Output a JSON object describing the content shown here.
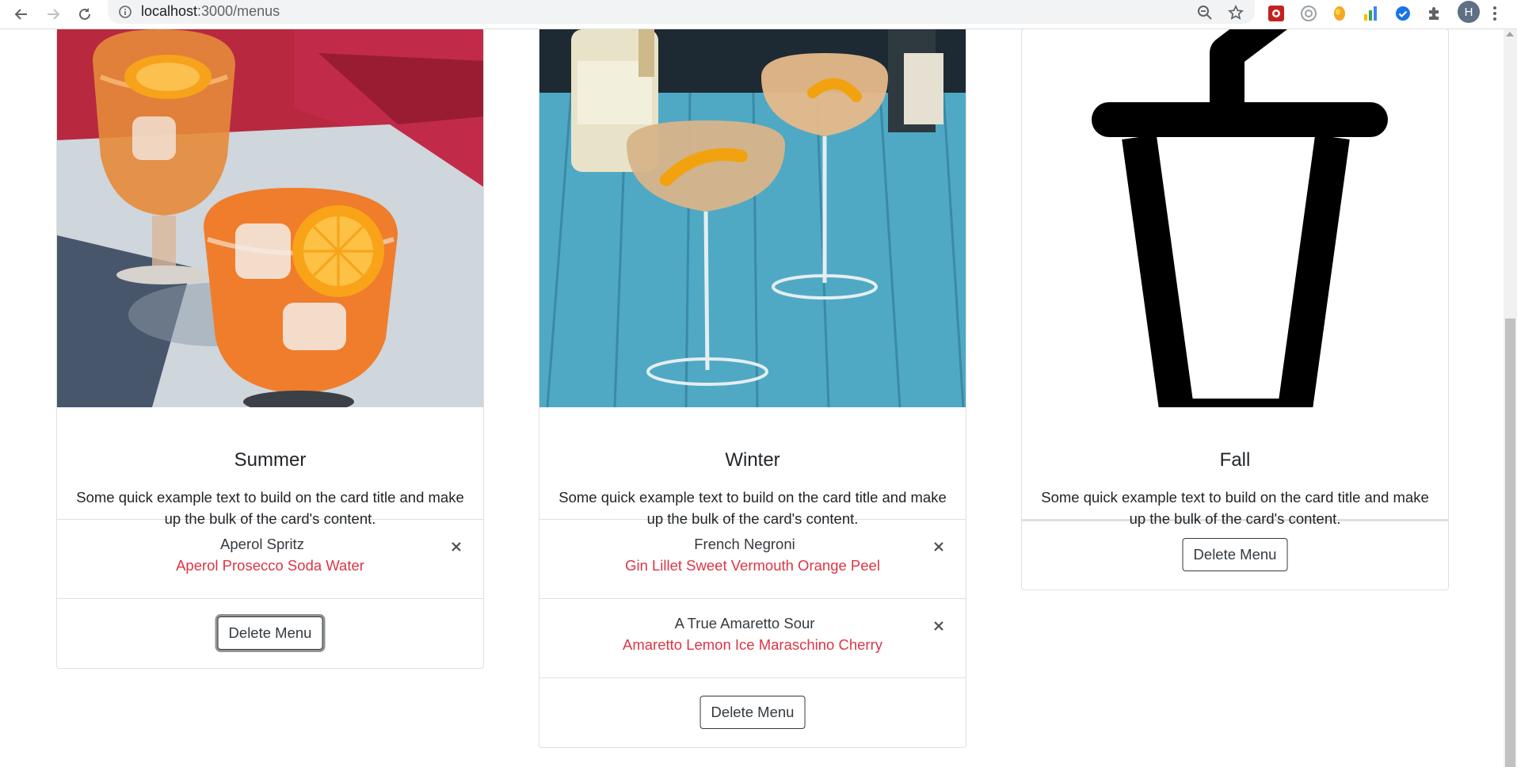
{
  "browser": {
    "url_host": "localhost",
    "url_rest": ":3000/menus",
    "avatar_letter": "H"
  },
  "menus": [
    {
      "title": "Summer",
      "text": "Some quick example text to build on the card title and make up the bulk of the card's content.",
      "drinks": [
        {
          "name": "Aperol Spritz",
          "ingredients": "Aperol Prosecco Soda Water"
        }
      ],
      "delete_label": "Delete Menu"
    },
    {
      "title": "Winter",
      "text": "Some quick example text to build on the card title and make up the bulk of the card's content.",
      "drinks": [
        {
          "name": "French Negroni",
          "ingredients": "Gin Lillet Sweet Vermouth Orange Peel"
        },
        {
          "name": "A True Amaretto Sour",
          "ingredients": "Amaretto Lemon Ice Maraschino Cherry"
        }
      ],
      "delete_label": "Delete Menu"
    },
    {
      "title": "Fall",
      "text": "Some quick example text to build on the card title and make up the bulk of the card's content.",
      "drinks": [],
      "delete_label": "Delete Menu"
    }
  ],
  "colors": {
    "ingredient_text": "#dc3545",
    "button_border": "#343a40",
    "summer_photo_bg": "#c9d3db",
    "winter_photo_bg": "#4fa9c4"
  }
}
